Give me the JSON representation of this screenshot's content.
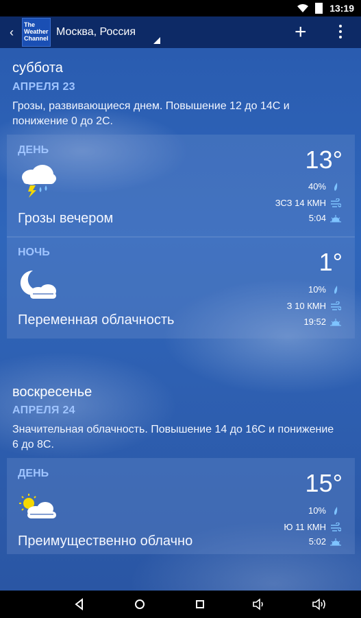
{
  "status": {
    "time": "13:19"
  },
  "header": {
    "logo_lines": [
      "The",
      "Weather",
      "Channel"
    ],
    "location": "Москва, Россия"
  },
  "days": [
    {
      "title": "суббота",
      "date": "АПРЕЛЯ 23",
      "description": "Грозы, развивающиеся днем. Повышение 12 до 14С и понижение 0 до 2С.",
      "periods": [
        {
          "label": "ДЕНЬ",
          "condition": "Грозы вечером",
          "temp": "13°",
          "precip": "40%",
          "wind": "ЗСЗ 14 КМН",
          "sun": "5:04",
          "icon": "thunderstorm-icon"
        },
        {
          "label": "НОЧЬ",
          "condition": "Переменная облачность",
          "temp": "1°",
          "precip": "10%",
          "wind": "З 10 КМН",
          "sun": "19:52",
          "icon": "moon-cloud-icon"
        }
      ]
    },
    {
      "title": "воскресенье",
      "date": "АПРЕЛЯ 24",
      "description": "Значительная облачность. Повышение 14 до 16С и понижение 6 до 8С.",
      "periods": [
        {
          "label": "ДЕНЬ",
          "condition": "Преимущественно облачно",
          "temp": "15°",
          "precip": "10%",
          "wind": "Ю 11 КМН",
          "sun": "5:02",
          "icon": "sun-cloud-icon"
        }
      ]
    }
  ]
}
